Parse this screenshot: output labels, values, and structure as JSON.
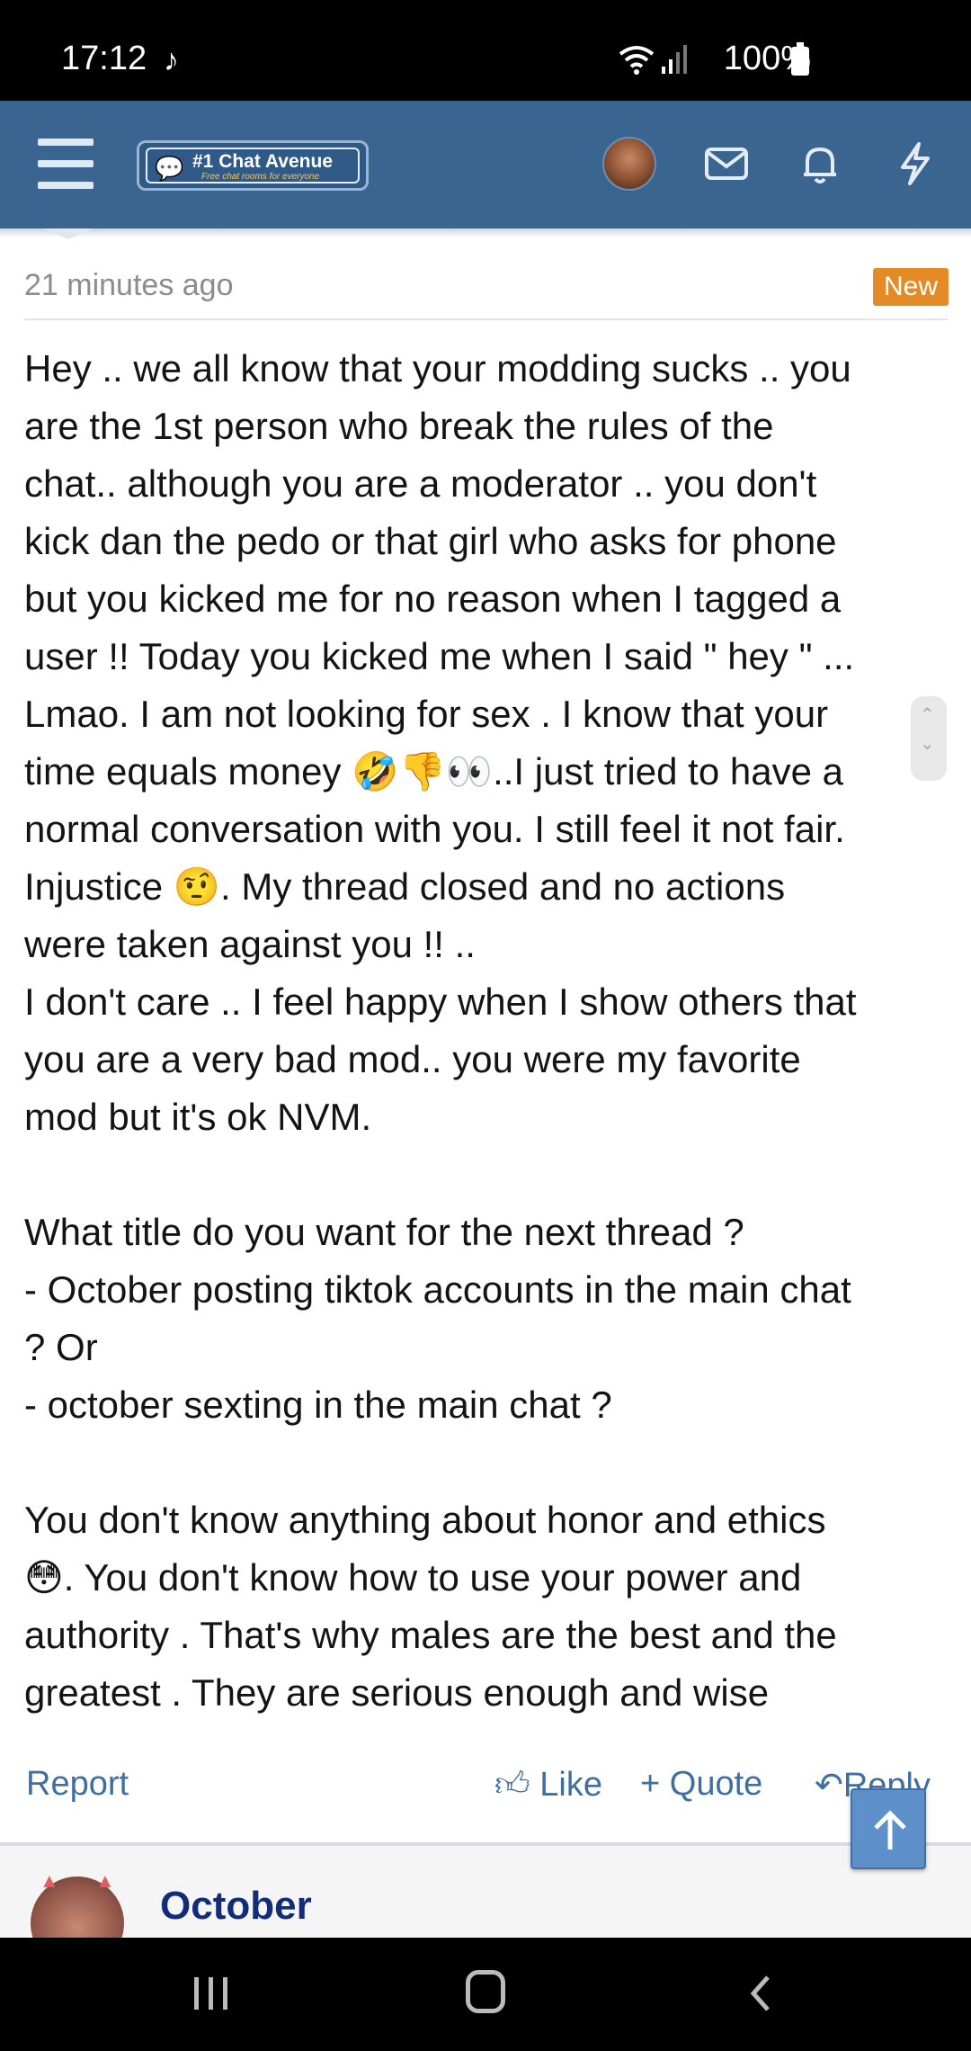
{
  "status_bar": {
    "time": "17:12",
    "battery": "100%",
    "tiktok_icon": "tiktok-icon",
    "wifi_icon": "wifi-icon",
    "signal_icon": "signal-icon",
    "battery_icon": "battery-icon"
  },
  "header": {
    "logo_title": "#1 Chat Avenue",
    "logo_subtitle": "Free chat rooms for everyone",
    "colors": {
      "bar": "#3a6591",
      "accent": "#e48a27",
      "link": "#3f6ea1"
    },
    "icons": [
      "menu-icon",
      "avatar",
      "mail-icon",
      "bell-icon",
      "lightning-icon"
    ]
  },
  "post": {
    "time_ago": "21 minutes ago",
    "badge": "New",
    "lines": [
      "Hey .. we all know that your modding sucks .. you",
      "are the 1st person who break the rules of the",
      "chat.. although you are a moderator .. you don't",
      "kick dan the pedo or that girl who asks for phone",
      "but you kicked me for no reason when I tagged a",
      "user !! Today you kicked me when I said \" hey \" ...",
      "Lmao. I am not looking for sex . I know that your",
      "",
      "normal conversation with you. I still feel it not fair.",
      "",
      "were taken against you !! ..",
      "I don't care .. I feel happy when I show others that",
      "you are a very bad mod.. you were my favorite",
      "mod but it's ok NVM.",
      "",
      "What title do you want for the next thread ?",
      "- October posting tiktok accounts in the main chat",
      "? Or",
      "- october sexting in the main chat ?",
      "",
      "You don't know anything about honor and ethics",
      "",
      "authority . That's why males are the best and the",
      "greatest . They are serious enough and wise"
    ],
    "line8_pre": "time equals money ",
    "line8_emoji": "🤣👎👀",
    "line8_post": "..I just tried to have a",
    "line10_pre": "Injustice ",
    "line10_emoji": "🤨",
    "line10_post": ". My thread closed and no actions",
    "line22_emoji": "😳",
    "line22_post": ". You don't know how to use your power and",
    "actions": {
      "report": "Report",
      "like": "Like",
      "quote": "Quote",
      "reply": "Reply"
    }
  },
  "next_post": {
    "author": "October"
  }
}
